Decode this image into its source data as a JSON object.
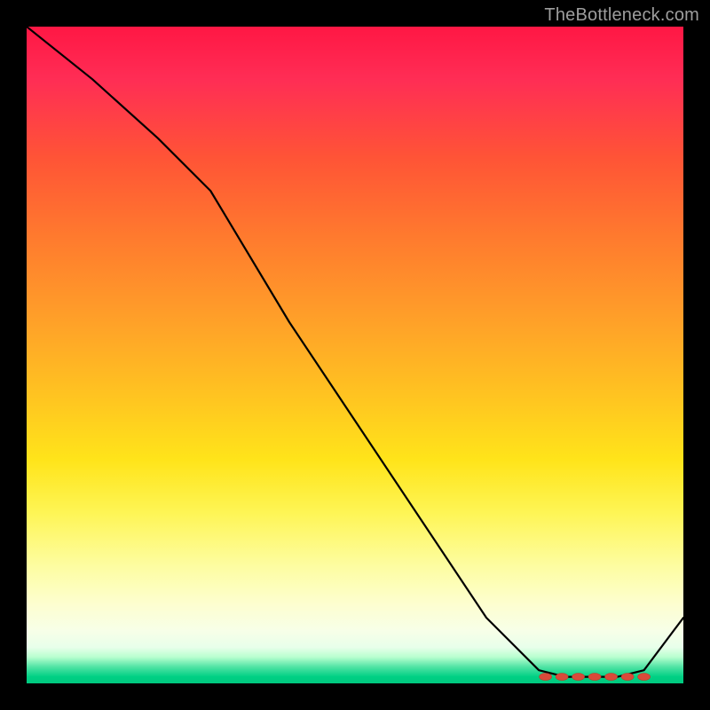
{
  "watermark": "TheBottleneck.com",
  "chart_data": {
    "type": "line",
    "title": "",
    "xlabel": "",
    "ylabel": "",
    "xlim": [
      0,
      100
    ],
    "ylim": [
      0,
      100
    ],
    "grid": false,
    "legend": false,
    "background": "rainbow-vertical-gradient",
    "series": [
      {
        "name": "bottleneck-curve",
        "x": [
          0,
          10,
          20,
          28,
          40,
          50,
          60,
          70,
          78,
          82,
          86,
          90,
          94,
          100
        ],
        "y": [
          100,
          92,
          83,
          75,
          55,
          40,
          25,
          10,
          2,
          1,
          1,
          1,
          2,
          10
        ]
      }
    ],
    "markers": {
      "name": "optimal-range",
      "shape": "ellipse",
      "color": "#d94a3a",
      "points_x": [
        79,
        81.5,
        84,
        86.5,
        89,
        91.5,
        94
      ],
      "points_y": [
        1,
        1,
        1,
        1,
        1,
        1,
        1
      ]
    }
  }
}
